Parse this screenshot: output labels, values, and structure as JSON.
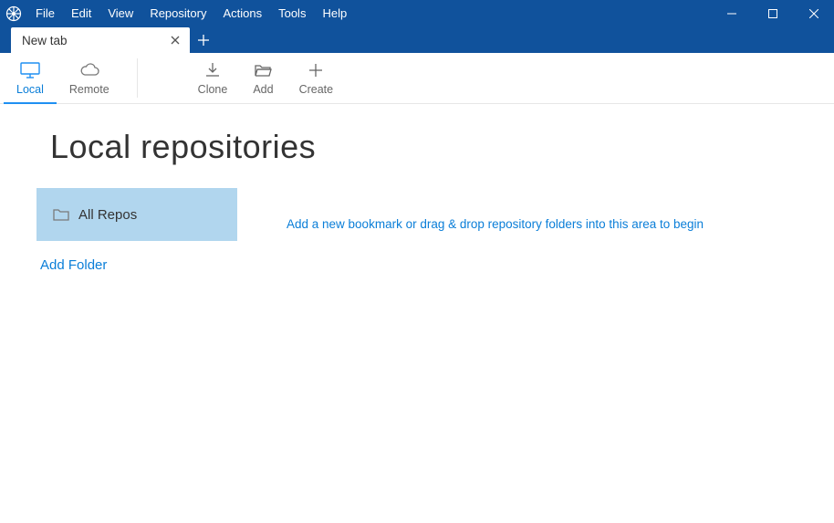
{
  "menu": {
    "items": [
      "File",
      "Edit",
      "View",
      "Repository",
      "Actions",
      "Tools",
      "Help"
    ]
  },
  "tab": {
    "title": "New tab"
  },
  "toolbar": {
    "local": "Local",
    "remote": "Remote",
    "clone": "Clone",
    "add": "Add",
    "create": "Create"
  },
  "page": {
    "title": "Local repositories",
    "all_repos": "All Repos",
    "add_folder": "Add Folder",
    "hint": "Add a new bookmark or drag & drop repository folders into this area to begin"
  }
}
